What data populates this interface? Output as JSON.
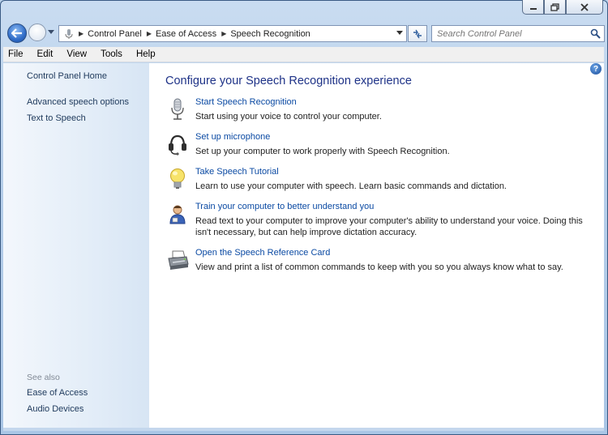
{
  "window": {
    "caption_buttons": [
      "minimize-icon",
      "restore-icon",
      "close-icon"
    ]
  },
  "address_bar": {
    "breadcrumbs": [
      "Control Panel",
      "Ease of Access",
      "Speech Recognition"
    ]
  },
  "search": {
    "placeholder": "Search Control Panel"
  },
  "menu": {
    "items": [
      "File",
      "Edit",
      "View",
      "Tools",
      "Help"
    ]
  },
  "sidebar": {
    "home": "Control Panel Home",
    "links": [
      "Advanced speech options",
      "Text to Speech"
    ],
    "see_also_label": "See also",
    "see_also": [
      "Ease of Access",
      "Audio Devices"
    ]
  },
  "main": {
    "title": "Configure your Speech Recognition experience",
    "tasks": [
      {
        "icon": "microphone-icon",
        "link": "Start Speech Recognition",
        "desc": "Start using your voice to control your computer."
      },
      {
        "icon": "headset-icon",
        "link": "Set up microphone",
        "desc": "Set up your computer to work properly with Speech Recognition."
      },
      {
        "icon": "lightbulb-icon",
        "link": "Take Speech Tutorial",
        "desc": "Learn to use your computer with speech.  Learn basic commands and dictation."
      },
      {
        "icon": "user-training-icon",
        "link": "Train your computer to better understand you",
        "desc": "Read text to your computer to improve your computer's ability to understand your voice.  Doing this isn't necessary, but can help improve dictation accuracy."
      },
      {
        "icon": "printer-icon",
        "link": "Open the Speech Reference Card",
        "desc": "View and print a list of common commands to keep with you so you always know what to say."
      }
    ]
  },
  "colors": {
    "link": "#0b4aa3",
    "title": "#1e3287",
    "sidebar_link": "#1e395b"
  }
}
